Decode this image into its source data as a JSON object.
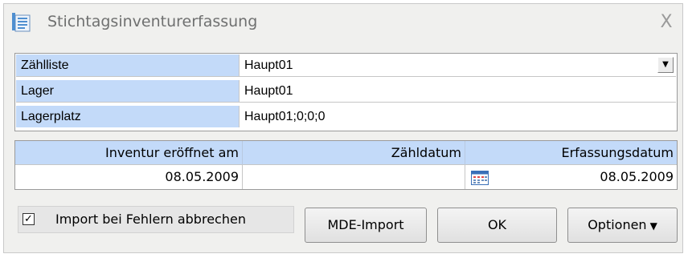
{
  "window": {
    "title": "Stichtagsinventurerfassung",
    "close_glyph": "X"
  },
  "fields": [
    {
      "label": "Zählliste",
      "value": "Haupt01",
      "has_dropdown": true
    },
    {
      "label": "Lager",
      "value": "Haupt01"
    },
    {
      "label": "Lagerplatz",
      "value": "Haupt01;0;0;0"
    }
  ],
  "dropdown_glyph": "▼",
  "dates": {
    "headers": {
      "inventur_eroeffnet_am": "Inventur eröffnet am",
      "zaehldatum": "Zähldatum",
      "erfassungsdatum": "Erfassungsdatum"
    },
    "values": {
      "inventur_eroeffnet_am": "08.05.2009",
      "zaehldatum": "",
      "erfassungsdatum": "08.05.2009"
    }
  },
  "options": {
    "import_abort_label": "Import bei Fehlern abbrechen",
    "import_abort_checked": true,
    "check_glyph": "✓"
  },
  "buttons": {
    "mde_import": "MDE-Import",
    "ok": "OK",
    "optionen": "Optionen",
    "optionen_caret": "▼"
  },
  "colors": {
    "header_bg": "#c3daf9",
    "window_bg": "#f0f0ee"
  }
}
